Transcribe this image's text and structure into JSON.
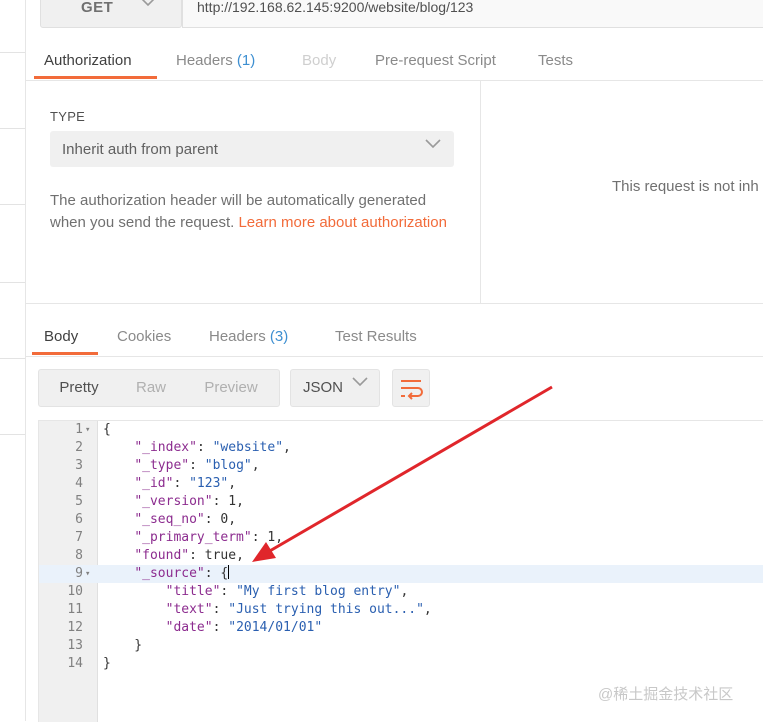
{
  "request": {
    "method": "GET",
    "url": "http://192.168.62.145:9200/website/blog/123"
  },
  "request_tabs": [
    {
      "label": "Authorization"
    },
    {
      "label": "Headers",
      "count": "(1)"
    },
    {
      "label": "Body"
    },
    {
      "label": "Pre-request Script"
    },
    {
      "label": "Tests"
    }
  ],
  "auth": {
    "type_label": "TYPE",
    "type_value": "Inherit auth from parent",
    "description": "The authorization header will be automatically generated when you send the request. ",
    "link_text": "Learn more about authorization",
    "side_note": "This request is not inh"
  },
  "response_tabs": [
    {
      "label": "Body"
    },
    {
      "label": "Cookies"
    },
    {
      "label": "Headers",
      "count": "(3)"
    },
    {
      "label": "Test Results"
    }
  ],
  "view_modes": [
    "Pretty",
    "Raw",
    "Preview"
  ],
  "format": "JSON",
  "code_lines": [
    {
      "n": "1",
      "fold": "▾",
      "text": "{"
    },
    {
      "n": "2",
      "fold": "",
      "key": "_index",
      "val": "\"website\"",
      "tail": ","
    },
    {
      "n": "3",
      "fold": "",
      "key": "_type",
      "val": "\"blog\"",
      "tail": ","
    },
    {
      "n": "4",
      "fold": "",
      "key": "_id",
      "val": "\"123\"",
      "tail": ","
    },
    {
      "n": "5",
      "fold": "",
      "key": "_version",
      "val": "1",
      "tail": ","
    },
    {
      "n": "6",
      "fold": "",
      "key": "_seq_no",
      "val": "0",
      "tail": ","
    },
    {
      "n": "7",
      "fold": "",
      "key": "_primary_term",
      "val": "1",
      "tail": ","
    },
    {
      "n": "8",
      "fold": "",
      "key": "found",
      "val": "true",
      "tail": ","
    },
    {
      "n": "9",
      "fold": "▾",
      "key": "_source",
      "val": "{",
      "tail": ""
    },
    {
      "n": "10",
      "fold": "",
      "key": "title",
      "val": "\"My first blog entry\"",
      "tail": ",",
      "nested": true
    },
    {
      "n": "11",
      "fold": "",
      "key": "text",
      "val": "\"Just trying this out...\"",
      "tail": ",",
      "nested": true
    },
    {
      "n": "12",
      "fold": "",
      "key": "date",
      "val": "\"2014/01/01\"",
      "tail": "",
      "nested": true
    },
    {
      "n": "13",
      "fold": "",
      "text": "    }"
    },
    {
      "n": "14",
      "fold": "",
      "text": "}"
    }
  ],
  "active_line": "9",
  "watermark": "@稀土掘金技术社区",
  "colors": {
    "accent": "#f26b3a",
    "count": "#3d8fd1",
    "arrow": "#e0262b"
  }
}
